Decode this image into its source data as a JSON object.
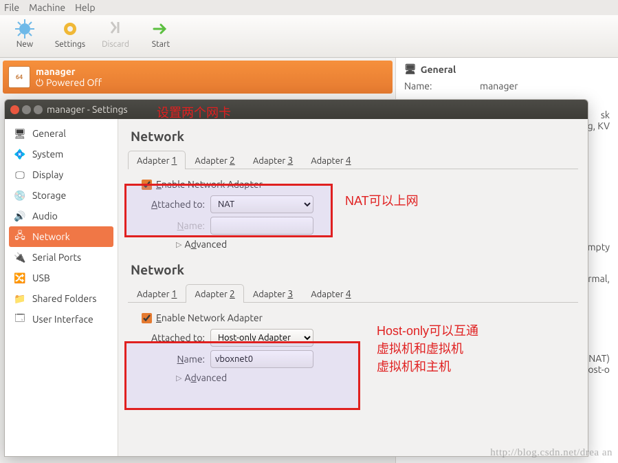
{
  "menubar": {
    "file": "File",
    "machine": "Machine",
    "help": "Help"
  },
  "toolbar": {
    "new": "New",
    "settings": "Settings",
    "discard": "Discard",
    "start": "Start"
  },
  "vm": {
    "name": "manager",
    "state": "Powered Off",
    "os_badge": "64"
  },
  "detail": {
    "general_title": "General",
    "name_lbl": "Name:",
    "name_val": "manager",
    "storage_tail": "sk\nging, KV",
    "empty": "Empty",
    "normal": "Normal,",
    "nat": ") (NAT)",
    "hostonly": ") (Host-o"
  },
  "dlg": {
    "title": "manager - Settings",
    "cats": [
      "General",
      "System",
      "Display",
      "Storage",
      "Audio",
      "Network",
      "Serial Ports",
      "USB",
      "Shared Folders",
      "User Interface"
    ],
    "panel_title": "Network",
    "tabs": [
      "Adapter 1",
      "Adapter 2",
      "Adapter 3",
      "Adapter 4"
    ],
    "enable": "Enable Network Adapter",
    "attached": "Attached to:",
    "name": "Name:",
    "advanced": "Advanced",
    "p1": {
      "active_tab": 0,
      "attached_val": "NAT",
      "name_val": ""
    },
    "p2": {
      "active_tab": 1,
      "attached_val": "Host-only Adapter",
      "name_val": "vboxnet0"
    }
  },
  "anno": {
    "a1": "设置两个网卡",
    "a2": "NAT可以上网",
    "a3": "Host-only可以互通\n虚拟机和虚拟机\n虚拟机和主机"
  },
  "watermark": "http://blog.csdn.net/drea  an",
  "colors": {
    "accent": "#f07746",
    "red": "#e02020"
  }
}
